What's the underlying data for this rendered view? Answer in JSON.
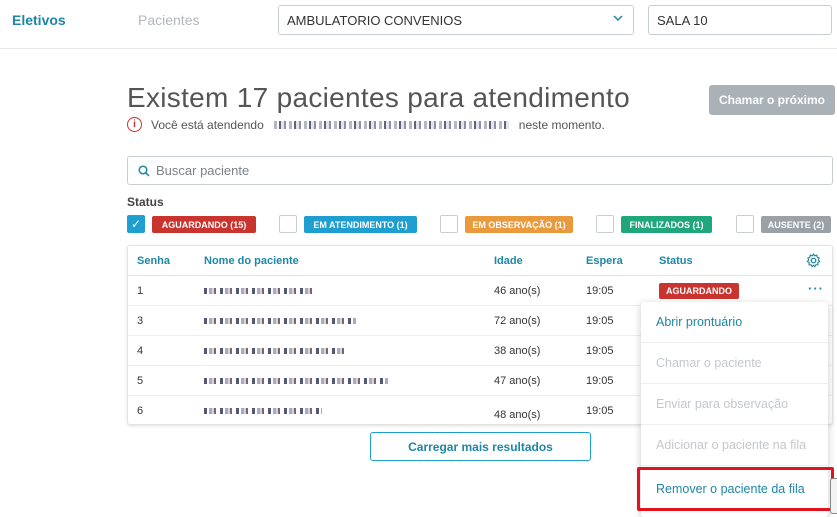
{
  "nav": {
    "eletivos": "Eletivos",
    "pacientes": "Pacientes"
  },
  "unit_select": {
    "value": "AMBULATORIO CONVENIOS",
    "icon": "chevron-down-icon"
  },
  "room_input": {
    "value": "SALA 10"
  },
  "header": {
    "title": "Existem 17 pacientes para atendimento",
    "subtitle_prefix": "Você está atendendo",
    "subtitle_suffix": "neste momento.",
    "call_next": "Chamar o próximo"
  },
  "search": {
    "placeholder": "Buscar paciente"
  },
  "filters": {
    "label": "Status",
    "items": [
      {
        "label": "AGUARDANDO (15)",
        "checked": true,
        "color": "#c9342f"
      },
      {
        "label": "EM ATENDIMENTO (1)",
        "checked": false,
        "color": "#1e9fd0"
      },
      {
        "label": "EM OBSERVAÇÃO (1)",
        "checked": false,
        "color": "#e89a3c"
      },
      {
        "label": "FINALIZADOS (1)",
        "checked": false,
        "color": "#20a67d"
      },
      {
        "label": "AUSENTE (2)",
        "checked": false,
        "color": "#9aa2a8"
      }
    ]
  },
  "table": {
    "headers": {
      "senha": "Senha",
      "nome": "Nome do paciente",
      "idade": "Idade",
      "espera": "Espera",
      "status": "Status"
    },
    "rows": [
      {
        "senha": "1",
        "idade": "46 ano(s)",
        "espera": "19:05",
        "status": "AGUARDANDO"
      },
      {
        "senha": "3",
        "idade": "72 ano(s)",
        "espera": "19:05"
      },
      {
        "senha": "4",
        "idade": "38 ano(s)",
        "espera": "19:05"
      },
      {
        "senha": "5",
        "idade": "47 ano(s)",
        "espera": "19:05"
      },
      {
        "senha": "6",
        "idade": "48 ano(s)",
        "espera": "19:05"
      }
    ],
    "row_menu_icon": "more-horizontal-icon",
    "settings_icon": "gear-icon"
  },
  "load_more": "Carregar mais resultados",
  "context_menu": {
    "items": [
      {
        "label": "Abrir prontuário",
        "enabled": true
      },
      {
        "label": "Chamar o paciente",
        "enabled": false
      },
      {
        "label": "Enviar para observação",
        "enabled": false
      },
      {
        "label": "Adicionar o paciente na fila",
        "enabled": false
      },
      {
        "label": "Remover o paciente da fila",
        "enabled": true
      }
    ]
  }
}
